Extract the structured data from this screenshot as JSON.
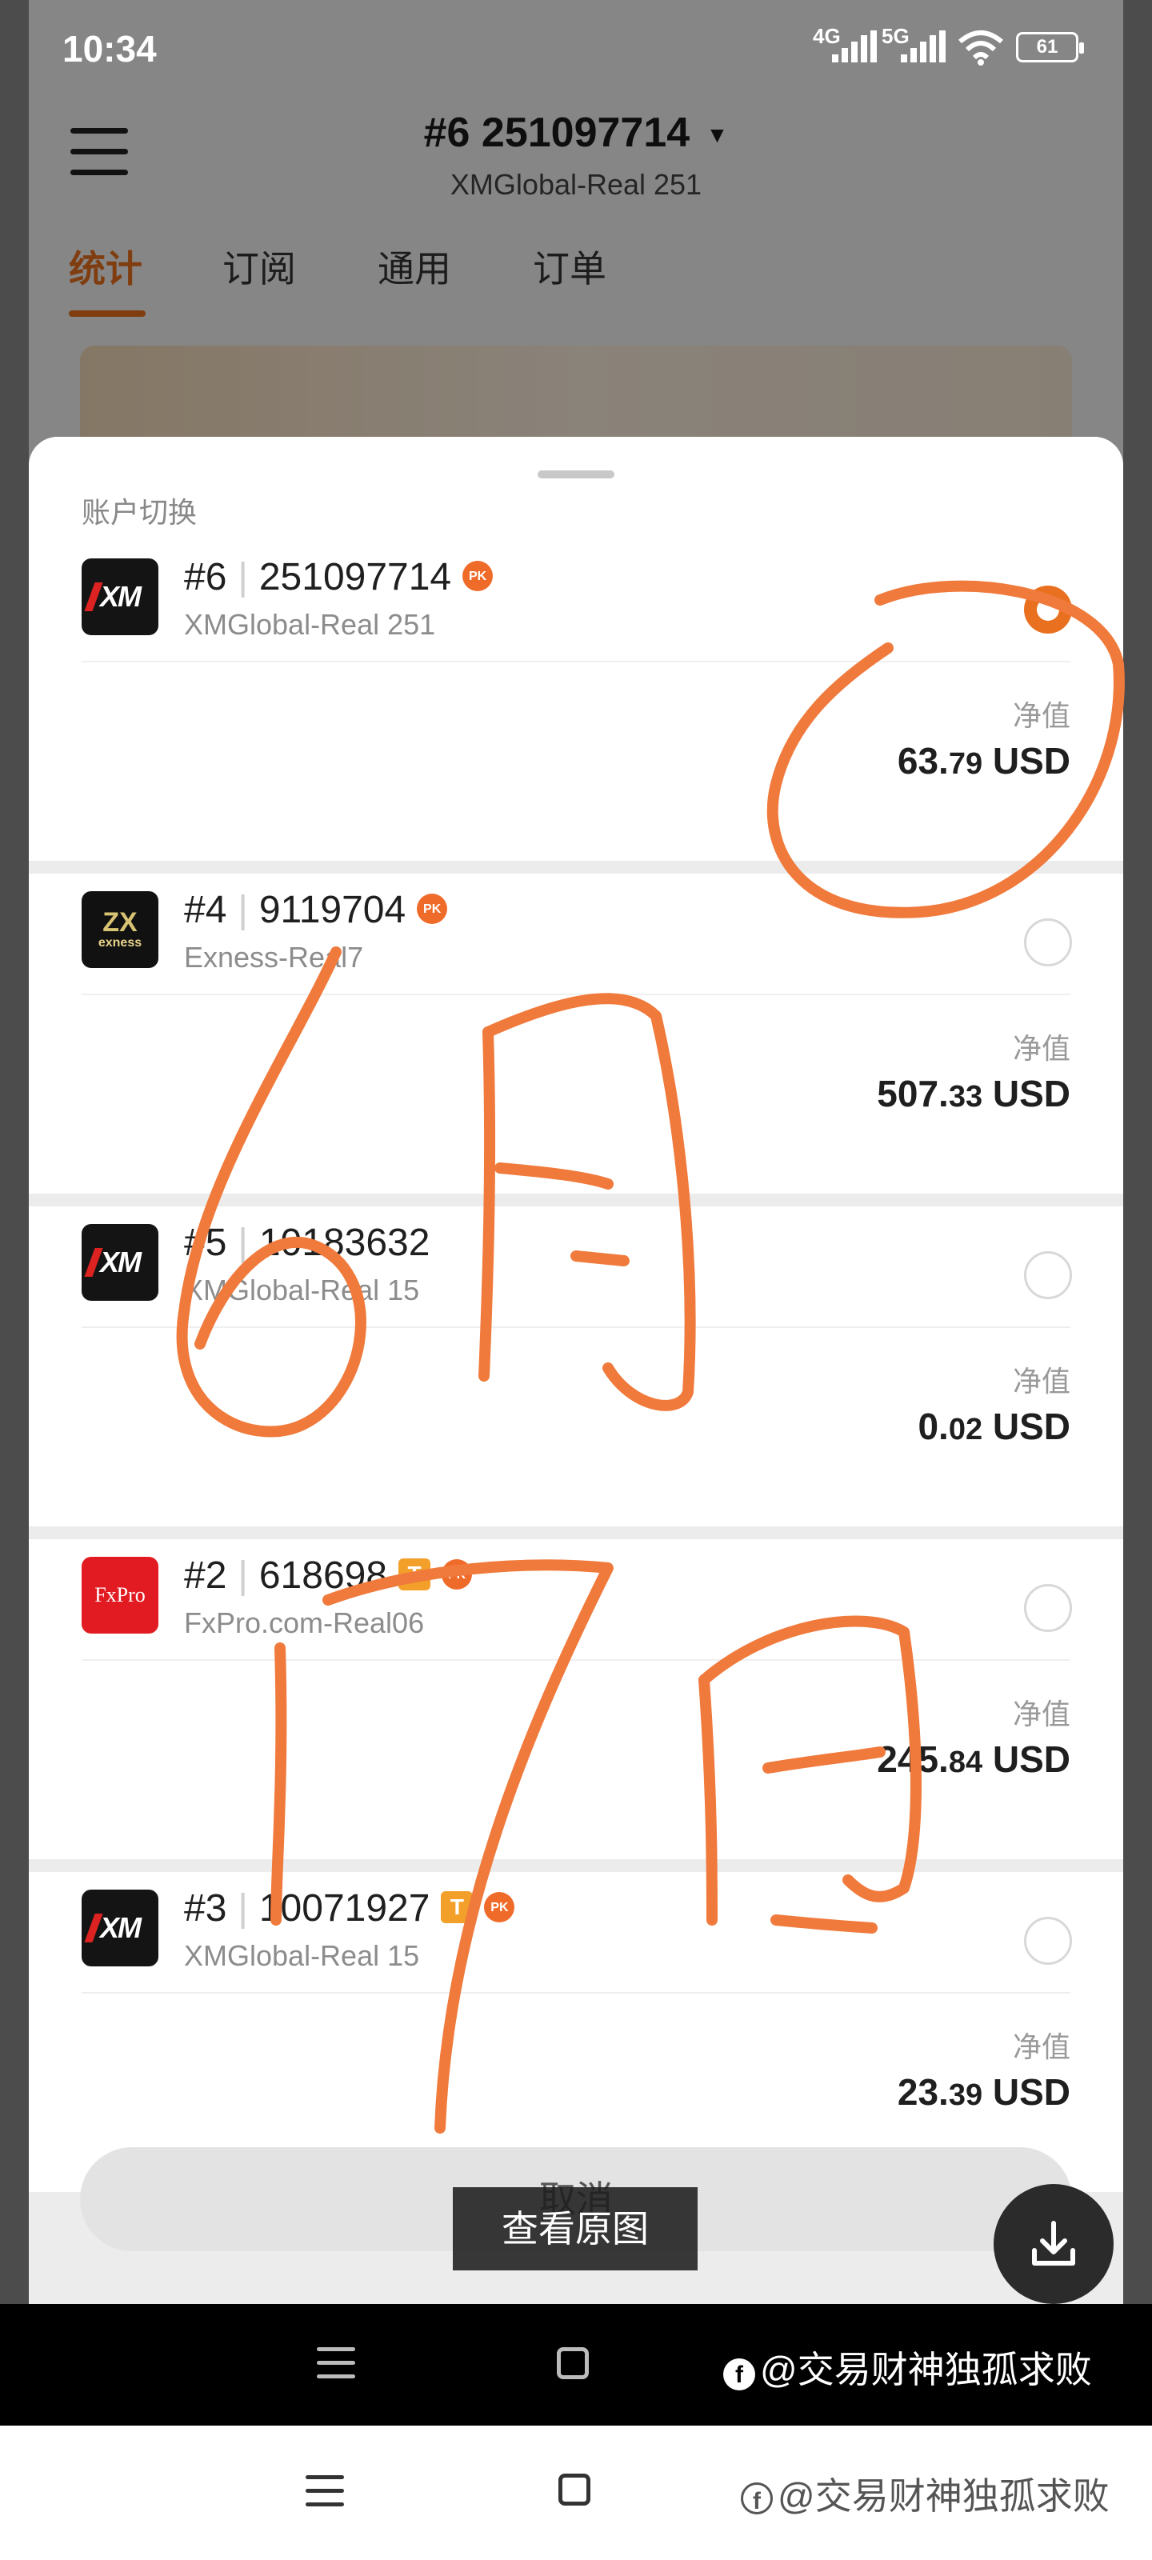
{
  "status_bar": {
    "time": "10:34",
    "network_1": "4G",
    "network_2": "5G",
    "battery": "61"
  },
  "header": {
    "account_title": "#6 251097714",
    "server": "XMGlobal-Real 251",
    "tabs": [
      {
        "label": "统计",
        "active": true
      },
      {
        "label": "订阅",
        "active": false
      },
      {
        "label": "通用",
        "active": false
      },
      {
        "label": "订单",
        "active": false
      }
    ]
  },
  "sheet": {
    "title": "账户切换",
    "equity_label": "净值",
    "cancel_label": "取消",
    "accounts": [
      {
        "index": "#6",
        "number": "251097714",
        "server": "XMGlobal-Real 251",
        "logo": "XM",
        "badges": [
          "PK"
        ],
        "equity_int": "63.",
        "equity_dec": "79",
        "currency": " USD",
        "selected": true
      },
      {
        "index": "#4",
        "number": "9119704",
        "server": "Exness-Real7",
        "logo": "exness",
        "badges": [
          "PK"
        ],
        "equity_int": "507.",
        "equity_dec": "33",
        "currency": " USD",
        "selected": false
      },
      {
        "index": "#5",
        "number": "10183632",
        "server": "XMGlobal-Real 15",
        "logo": "XM",
        "badges": [],
        "equity_int": "0.",
        "equity_dec": "02",
        "currency": " USD",
        "selected": false
      },
      {
        "index": "#2",
        "number": "618698",
        "server": "FxPro.com-Real06",
        "logo": "FxPro",
        "badges": [
          "T",
          "PK"
        ],
        "equity_int": "245.",
        "equity_dec": "84",
        "currency": " USD",
        "selected": false
      },
      {
        "index": "#3",
        "number": "10071927",
        "server": "XMGlobal-Real 15",
        "logo": "XM",
        "badges": [
          "T",
          "PK"
        ],
        "equity_int": "23.",
        "equity_dec": "39",
        "currency": " USD",
        "selected": false
      }
    ]
  },
  "viewer": {
    "view_original_label": "查看原图",
    "watermark": "@交易财神独孤求败"
  },
  "colors": {
    "accent": "#e8701e",
    "annotation": "#f07a3c"
  },
  "icons": {
    "menu": "hamburger-icon",
    "dropdown": "caret-down-icon",
    "download": "download-icon",
    "nav_menu": "nav-menu-icon",
    "nav_home": "nav-home-icon"
  }
}
